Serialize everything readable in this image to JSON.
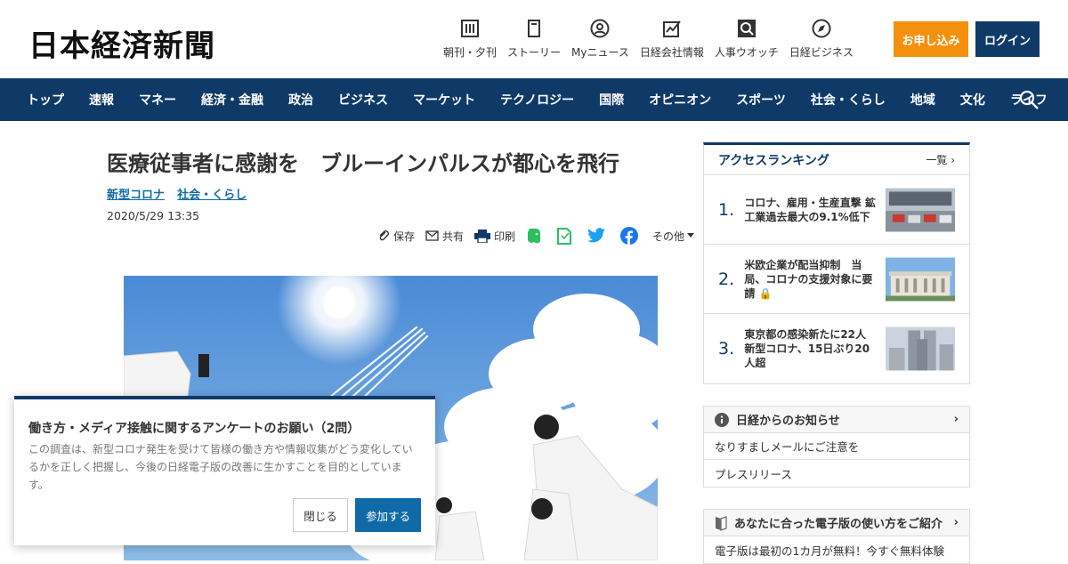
{
  "header": {
    "logo": "日本経済新聞",
    "nav": [
      {
        "label": "朝刊・夕刊",
        "icon": "newspaper-icon"
      },
      {
        "label": "ストーリー",
        "icon": "book-icon"
      },
      {
        "label": "Myニュース",
        "icon": "user-icon"
      },
      {
        "label": "日経会社情報",
        "icon": "chart-icon"
      },
      {
        "label": "人事ウオッチ",
        "icon": "magnifier-icon"
      },
      {
        "label": "日経ビジネス",
        "icon": "compass-icon"
      }
    ],
    "apply_label": "お申し込み",
    "login_label": "ログイン"
  },
  "gnav": [
    "トップ",
    "速報",
    "マネー",
    "経済・金融",
    "政治",
    "ビジネス",
    "マーケット",
    "テクノロジー",
    "国際",
    "オピニオン",
    "スポーツ",
    "社会・くらし",
    "地域",
    "文化",
    "ライフ"
  ],
  "article": {
    "headline": "医療従事者に感謝を　ブルーインパルスが都心を飛行",
    "tags": [
      "新型コロナ",
      "社会・くらし"
    ],
    "date": "2020/5/29 13:35",
    "share": {
      "save": "保存",
      "share": "共有",
      "print": "印刷",
      "more": "その他"
    }
  },
  "ranking": {
    "title": "アクセスランキング",
    "more": "一覧",
    "items": [
      {
        "num": "1.",
        "text": "コロナ、雇用・生産直撃 鉱工業過去最大の9.1%低下"
      },
      {
        "num": "2.",
        "text": "米欧企業が配当抑制　当局、コロナの支援対象に要請"
      },
      {
        "num": "3.",
        "text": "東京都の感染新たに22人 新型コロナ、15日ぶり20人超"
      }
    ]
  },
  "notices": {
    "title": "日経からのお知らせ",
    "items": [
      "なりすましメールにご注意を",
      "プレスリリース"
    ]
  },
  "guide": {
    "title": "あなたに合った電子版の使い方をご紹介",
    "text": "電子版は最初の1カ月が無料！今すぐ無料体験"
  },
  "survey": {
    "title": "働き方・メディア接触に関するアンケートのお願い（2問）",
    "body": "この調査は、新型コロナ発生を受けて皆様の働き方や情報収集がどう変化しているかを正しく把握し、今後の日経電子版の改善に生かすことを目的としています。",
    "close_label": "閉じる",
    "join_label": "参加する"
  },
  "colors": {
    "brand": "#0f3a68",
    "apply": "#f5900c",
    "link": "#0f6aa7"
  }
}
